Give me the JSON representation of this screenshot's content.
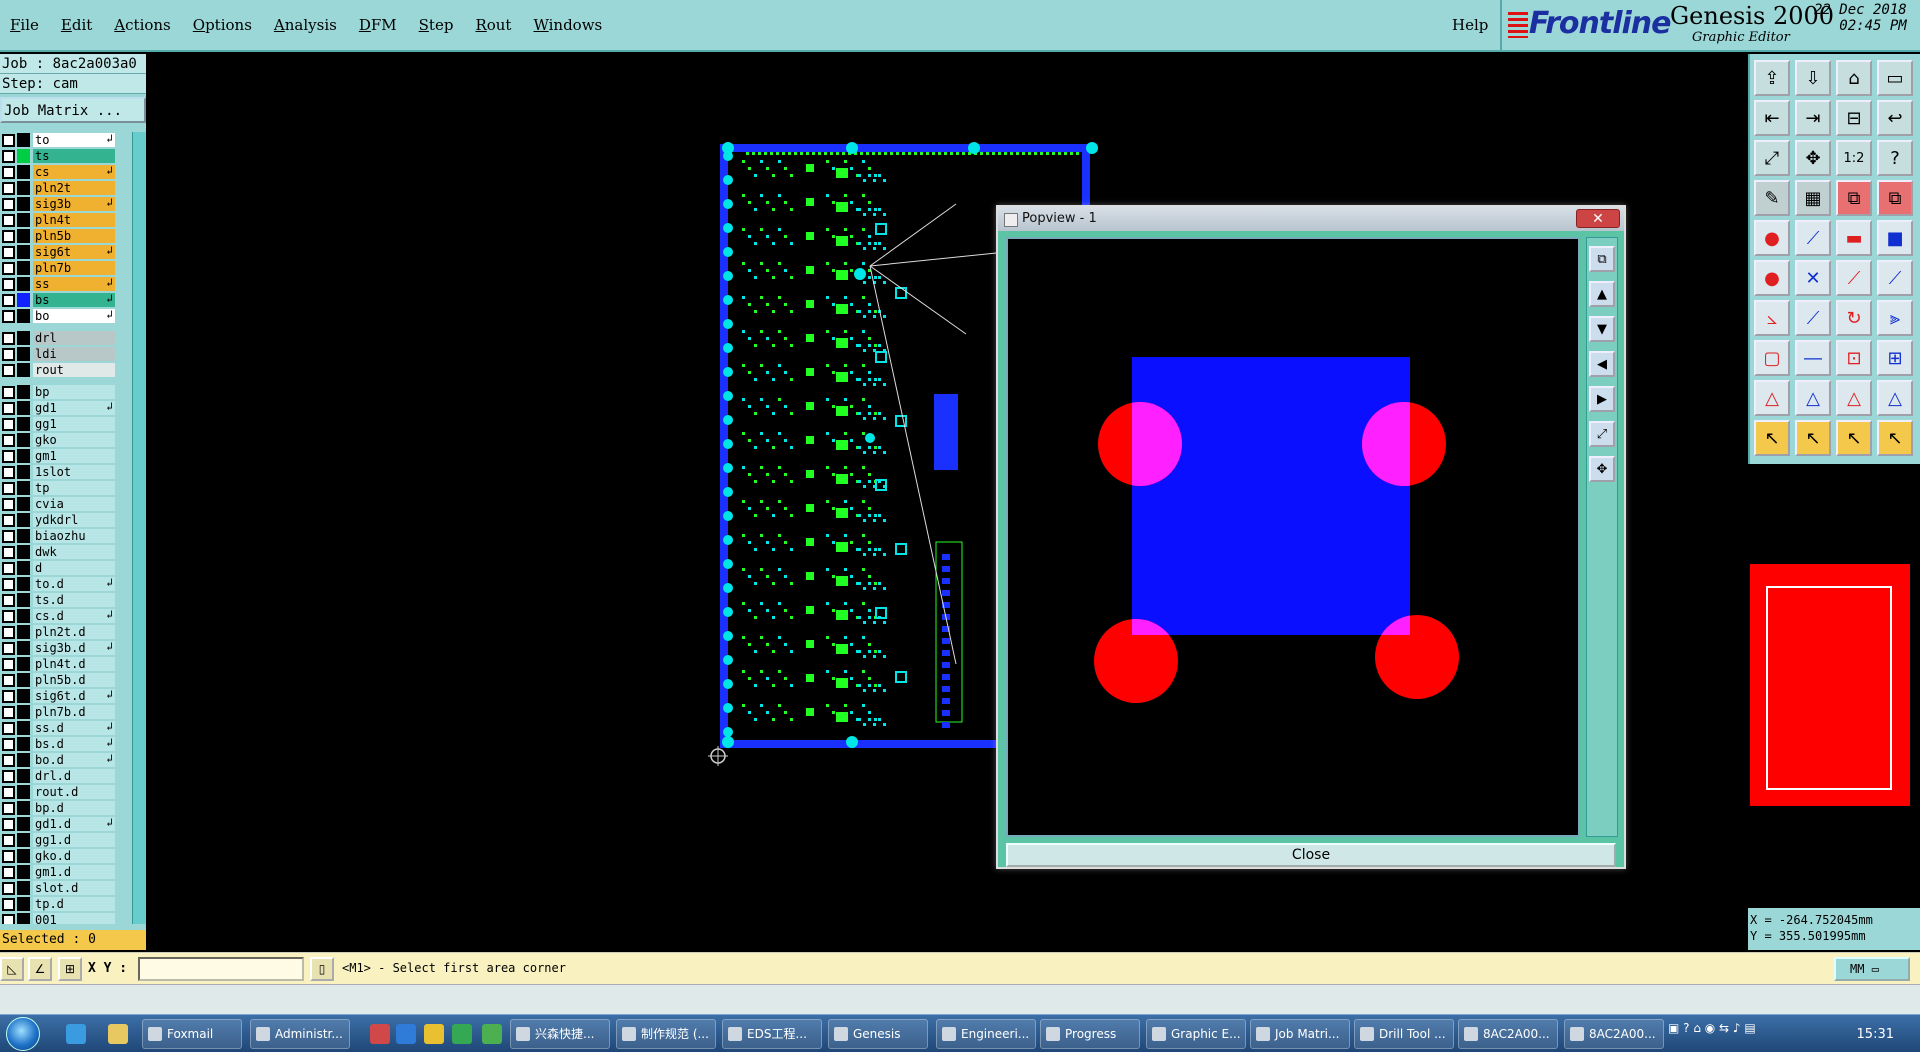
{
  "menubar": {
    "items": [
      {
        "letter": "F",
        "rest": "ile"
      },
      {
        "letter": "E",
        "rest": "dit"
      },
      {
        "letter": "A",
        "rest": "ctions"
      },
      {
        "letter": "O",
        "rest": "ptions"
      },
      {
        "letter": "A",
        "rest": "nalysis"
      },
      {
        "letter": "D",
        "rest": "FM"
      },
      {
        "letter": "S",
        "rest": "tep"
      },
      {
        "letter": "R",
        "rest": "out"
      },
      {
        "letter": "W",
        "rest": "indows"
      }
    ],
    "help": "Help"
  },
  "brand": {
    "logo": "Frontline",
    "product": "Genesis 2000",
    "subtitle": "Graphic Editor",
    "date": "22 Dec 2018",
    "time": "02:45 PM"
  },
  "job": {
    "job_line": "Job : 8ac2a003a0",
    "step_line": "Step: cam",
    "matrix_button": "Job Matrix ..."
  },
  "layers": [
    {
      "name": "to",
      "color": "#000000",
      "bg": "#ffffff",
      "arrow": true
    },
    {
      "name": "ts",
      "color": "#00cc44",
      "bg": "#33b38f",
      "arrow": false
    },
    {
      "name": "cs",
      "color": "#000000",
      "bg": "#f0b030",
      "arrow": true
    },
    {
      "name": "pln2t",
      "color": "#000000",
      "bg": "#f0b030",
      "arrow": false
    },
    {
      "name": "sig3b",
      "color": "#000000",
      "bg": "#f0b030",
      "arrow": true
    },
    {
      "name": "pln4t",
      "color": "#000000",
      "bg": "#f0b030",
      "arrow": false
    },
    {
      "name": "pln5b",
      "color": "#000000",
      "bg": "#f0b030",
      "arrow": false
    },
    {
      "name": "sig6t",
      "color": "#000000",
      "bg": "#f0b030",
      "arrow": true
    },
    {
      "name": "pln7b",
      "color": "#000000",
      "bg": "#f0b030",
      "arrow": false
    },
    {
      "name": "ss",
      "color": "#000000",
      "bg": "#f0b030",
      "arrow": true
    },
    {
      "name": "bs",
      "color": "#1020ff",
      "bg": "#33b38f",
      "arrow": true
    },
    {
      "name": "bo",
      "color": "#000000",
      "bg": "#ffffff",
      "arrow": true,
      "gap_after": true
    },
    {
      "name": "drl",
      "color": "#000000",
      "bg": "#b8c8c8",
      "arrow": false
    },
    {
      "name": "ldi",
      "color": "#000000",
      "bg": "#b8c8c8",
      "arrow": false
    },
    {
      "name": "rout",
      "color": "#000000",
      "bg": "#e0e8e8",
      "arrow": false,
      "gap_after": true
    },
    {
      "name": "bp",
      "color": "#000000",
      "bg": "#b8e6e6",
      "arrow": false
    },
    {
      "name": "gd1",
      "color": "#000000",
      "bg": "#b8e6e6",
      "arrow": true
    },
    {
      "name": "gg1",
      "color": "#000000",
      "bg": "#b8e6e6",
      "arrow": false
    },
    {
      "name": "gko",
      "color": "#000000",
      "bg": "#b8e6e6",
      "arrow": false
    },
    {
      "name": "gm1",
      "color": "#000000",
      "bg": "#b8e6e6",
      "arrow": false
    },
    {
      "name": "1slot",
      "color": "#000000",
      "bg": "#b8e6e6",
      "arrow": false
    },
    {
      "name": "tp",
      "color": "#000000",
      "bg": "#b8e6e6",
      "arrow": false
    },
    {
      "name": "cvia",
      "color": "#000000",
      "bg": "#b8e6e6",
      "arrow": false
    },
    {
      "name": "ydkdrl",
      "color": "#000000",
      "bg": "#b8e6e6",
      "arrow": false
    },
    {
      "name": "biaozhu",
      "color": "#000000",
      "bg": "#b8e6e6",
      "arrow": false
    },
    {
      "name": "dwk",
      "color": "#000000",
      "bg": "#b8e6e6",
      "arrow": false
    },
    {
      "name": "d",
      "color": "#000000",
      "bg": "#b8e6e6",
      "arrow": false
    },
    {
      "name": "to.d",
      "color": "#000000",
      "bg": "#b8e6e6",
      "arrow": true
    },
    {
      "name": "ts.d",
      "color": "#000000",
      "bg": "#b8e6e6",
      "arrow": false
    },
    {
      "name": "cs.d",
      "color": "#000000",
      "bg": "#b8e6e6",
      "arrow": true
    },
    {
      "name": "pln2t.d",
      "color": "#000000",
      "bg": "#b8e6e6",
      "arrow": false
    },
    {
      "name": "sig3b.d",
      "color": "#000000",
      "bg": "#b8e6e6",
      "arrow": true
    },
    {
      "name": "pln4t.d",
      "color": "#000000",
      "bg": "#b8e6e6",
      "arrow": false
    },
    {
      "name": "pln5b.d",
      "color": "#000000",
      "bg": "#b8e6e6",
      "arrow": false
    },
    {
      "name": "sig6t.d",
      "color": "#000000",
      "bg": "#b8e6e6",
      "arrow": true
    },
    {
      "name": "pln7b.d",
      "color": "#000000",
      "bg": "#b8e6e6",
      "arrow": false
    },
    {
      "name": "ss.d",
      "color": "#000000",
      "bg": "#b8e6e6",
      "arrow": true
    },
    {
      "name": "bs.d",
      "color": "#000000",
      "bg": "#b8e6e6",
      "arrow": true
    },
    {
      "name": "bo.d",
      "color": "#000000",
      "bg": "#b8e6e6",
      "arrow": true
    },
    {
      "name": "drl.d",
      "color": "#000000",
      "bg": "#b8e6e6",
      "arrow": false
    },
    {
      "name": "rout.d",
      "color": "#000000",
      "bg": "#b8e6e6",
      "arrow": false
    },
    {
      "name": "bp.d",
      "color": "#000000",
      "bg": "#b8e6e6",
      "arrow": false
    },
    {
      "name": "gd1.d",
      "color": "#000000",
      "bg": "#b8e6e6",
      "arrow": true
    },
    {
      "name": "gg1.d",
      "color": "#000000",
      "bg": "#b8e6e6",
      "arrow": false
    },
    {
      "name": "gko.d",
      "color": "#000000",
      "bg": "#b8e6e6",
      "arrow": false
    },
    {
      "name": "gm1.d",
      "color": "#000000",
      "bg": "#b8e6e6",
      "arrow": false
    },
    {
      "name": "slot.d",
      "color": "#000000",
      "bg": "#b8e6e6",
      "arrow": false
    },
    {
      "name": "tp.d",
      "color": "#000000",
      "bg": "#b8e6e6",
      "arrow": false
    },
    {
      "name": "001",
      "color": "#000000",
      "bg": "#b8e6e6",
      "arrow": false
    }
  ],
  "status": {
    "selected": "Selected : 0",
    "coord_x": "X = -264.752045mm",
    "coord_y": "Y = 355.501995mm"
  },
  "popview": {
    "title": "Popview - 1",
    "close_label": "Close",
    "close_x": "✕"
  },
  "command": {
    "xy_label": "X Y :",
    "xy_value": "",
    "prompt": "<M1> - Select first area corner",
    "units": "MM"
  },
  "taskbar": {
    "buttons": [
      "Foxmail",
      "Administr...",
      "兴森快捷...",
      "制作规范 (...",
      "EDS工程...",
      "Genesis",
      "Engineeri...",
      "Progress",
      "Graphic E...",
      "Job Matri...",
      "Drill Tool ...",
      "8AC2A00...",
      "8AC2A00..."
    ],
    "clock": "15:31"
  },
  "colors": {
    "panel": "#9cd7d7",
    "board_outline": "#1a30ff",
    "pad_blue": "#0a10ff",
    "pad_red": "#ff0000",
    "pad_magenta": "#ff20ff",
    "trace_green": "#22ff22",
    "via_cyan": "#00e6e6"
  },
  "icons": {
    "right_toolbar": [
      "open-icon",
      "save-icon",
      "home-icon",
      "window-icon",
      "import-icon",
      "export-icon",
      "split-icon",
      "redo-icon",
      "zoom-fit-icon",
      "zoom-in-icon",
      "scale-1to2-icon",
      "help-icon",
      "measure-icon",
      "grid-icon",
      "netlist-icon",
      "netlist-compare-icon",
      "snap-icon",
      "line-icon",
      "slot-icon",
      "pad-icon",
      "node-icon",
      "cross-icon",
      "arc-point-icon",
      "arc-line-icon",
      "angle-icon",
      "slope-icon",
      "rotate-icon",
      "mirror-icon",
      "select-box-icon",
      "minus-icon",
      "align-icon",
      "group-icon",
      "triangle-icon",
      "triangle-a-icon",
      "triangle-b-icon",
      "triangle-c-icon",
      "pointer-icon",
      "pointer-box-icon",
      "pointer-dot-icon",
      "pointer-move-icon"
    ]
  }
}
